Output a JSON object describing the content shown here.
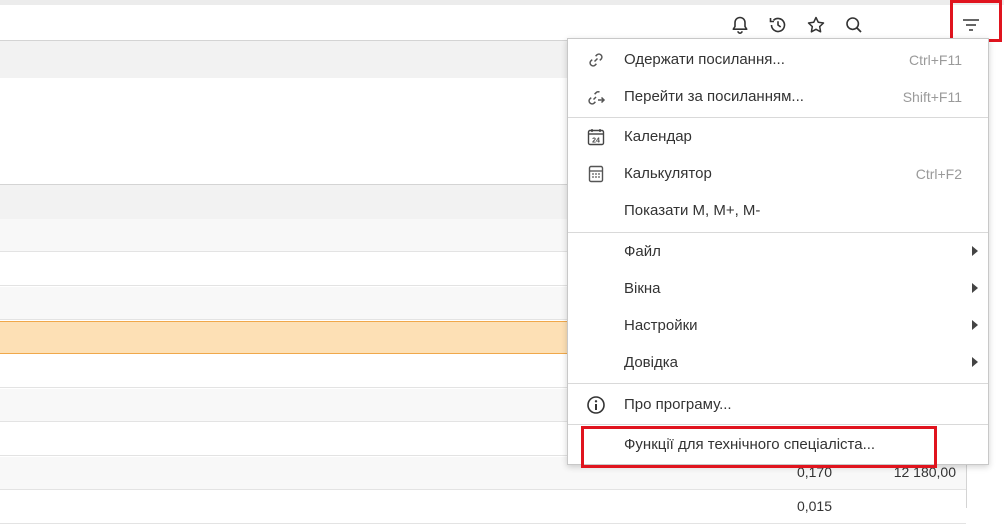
{
  "toolbar": {
    "icons": [
      "bell-icon",
      "history-icon",
      "star-icon",
      "search-icon",
      "main-menu-icon"
    ]
  },
  "table": {
    "rows": [
      {
        "c1": "",
        "c2": ""
      },
      {
        "c1": "",
        "c2": ""
      },
      {
        "c1": "",
        "c2": ""
      },
      {
        "c1": "",
        "c2": ""
      },
      {
        "c1": "",
        "c2": ""
      },
      {
        "c1": "",
        "c2": ""
      },
      {
        "c1": "",
        "c2": ""
      },
      {
        "c1": "0,170",
        "c2": "12 180,00"
      },
      {
        "c1": "0,015",
        "c2": ""
      }
    ]
  },
  "menu": {
    "get_link": {
      "label": "Одержати посилання...",
      "shortcut": "Ctrl+F11"
    },
    "go_to_link": {
      "label": "Перейти за посиланням...",
      "shortcut": "Shift+F11"
    },
    "calendar": {
      "label": "Календар",
      "icon_text": "24"
    },
    "calculator": {
      "label": "Калькулятор",
      "shortcut": "Ctrl+F2"
    },
    "show_memory": {
      "label": "Показати M, M+, M-"
    },
    "file": {
      "label": "Файл"
    },
    "windows": {
      "label": "Вікна"
    },
    "settings": {
      "label": "Настройки"
    },
    "help": {
      "label": "Довідка"
    },
    "about": {
      "label": "Про програму..."
    },
    "tech_functions": {
      "label": "Функції для технічного спеціаліста..."
    }
  },
  "colors": {
    "highlight": "#e0141e",
    "selected_row": "#fde0b5"
  }
}
